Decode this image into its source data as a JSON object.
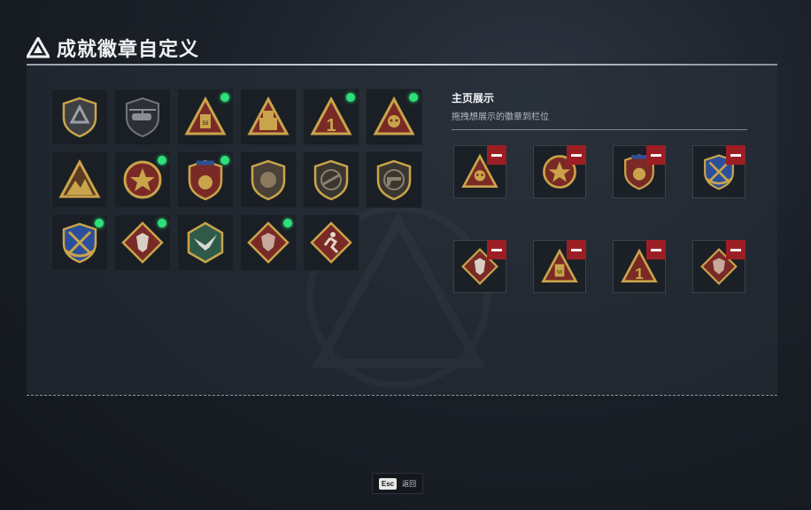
{
  "header": {
    "title": "成就徽章自定义",
    "logo_icon": "delta-logo-icon"
  },
  "owned_badges": [
    {
      "icon": "delta-shield-badge-icon",
      "new": false
    },
    {
      "icon": "helicopter-badge-icon",
      "new": false
    },
    {
      "icon": "backpack-triangle-badge-icon",
      "new": true
    },
    {
      "icon": "fortress-triangle-badge-icon",
      "new": false
    },
    {
      "icon": "number-one-triangle-badge-icon",
      "new": true
    },
    {
      "icon": "skull-triangle-badge-icon",
      "new": true
    },
    {
      "icon": "mountain-triangle-badge-icon",
      "new": false
    },
    {
      "icon": "star-medal-badge-icon",
      "new": true
    },
    {
      "icon": "laurel-shield-badge-icon",
      "new": true
    },
    {
      "icon": "lion-shield-badge-icon",
      "new": false
    },
    {
      "icon": "rifle-shield-badge-icon",
      "new": false
    },
    {
      "icon": "pistol-shield-badge-icon",
      "new": false
    },
    {
      "icon": "crossed-rifles-shield-badge-icon",
      "new": true
    },
    {
      "icon": "wolf-diamond-badge-icon",
      "new": true
    },
    {
      "icon": "eagle-hexagon-badge-icon",
      "new": false
    },
    {
      "icon": "dragon-diamond-badge-icon",
      "new": true
    },
    {
      "icon": "runner-diamond-badge-icon",
      "new": false
    }
  ],
  "showcase": {
    "title": "主页展示",
    "subtitle": "拖拽想展示的徽章到栏位",
    "slots": [
      {
        "icon": "skull-triangle-badge-icon"
      },
      {
        "icon": "star-medal-badge-icon"
      },
      {
        "icon": "laurel-shield-badge-icon"
      },
      {
        "icon": "crossed-rifles-shield-badge-icon"
      },
      {
        "icon": "wolf-diamond-badge-icon"
      },
      {
        "icon": "backpack-triangle-badge-icon"
      },
      {
        "icon": "number-one-triangle-badge-icon"
      },
      {
        "icon": "dragon-diamond-badge-icon"
      }
    ]
  },
  "footer": {
    "esc_key": "Esc",
    "esc_label": "返回"
  },
  "colors": {
    "new_dot": "#2ee07a",
    "remove_button": "#9b1e24",
    "gold": "#c9a44a",
    "maroon": "#7a2a26"
  }
}
